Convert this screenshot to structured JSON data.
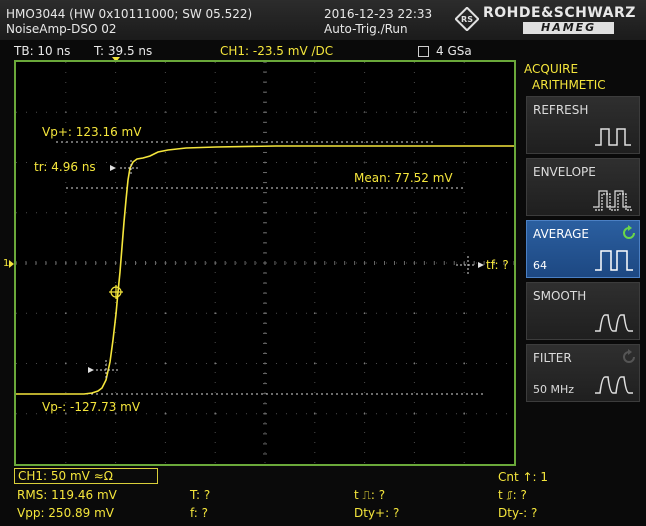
{
  "header": {
    "model": "HMO3044 (HW 0x10111000; SW 05.522)",
    "datetime": "2016-12-23 22:33",
    "setup_name": "NoiseAmp-DSO 02",
    "trigger_mode": "Auto-Trig./Run",
    "brand_line1": "ROHDE&SCHWARZ",
    "brand_line2": "HAMEG"
  },
  "status": {
    "timebase": "TB: 10 ns",
    "trigger_pos": "T: 39.5 ns",
    "ch1_trigger": "CH1: -23.5 mV ∕DC",
    "sample_rate": "4 GSa"
  },
  "plot": {
    "vp_plus": "Vp+: 123.16 mV",
    "rise_time": "tr: 4.96 ns",
    "mean": "Mean: 77.52 mV",
    "fall_time": "tf: ?",
    "vp_minus": "Vp-: -127.73 mV",
    "ch_marker": "1"
  },
  "menu": {
    "title1": "ACQUIRE",
    "title2": "ARITHMETIC",
    "items": [
      {
        "label": "REFRESH",
        "sub": ""
      },
      {
        "label": "ENVELOPE",
        "sub": ""
      },
      {
        "label": "AVERAGE",
        "sub": "64"
      },
      {
        "label": "SMOOTH",
        "sub": ""
      },
      {
        "label": "FILTER",
        "sub": "50 MHz"
      }
    ]
  },
  "bottom": {
    "ch1_setting": "CH1: 50 mV ≈Ω",
    "rms": "RMS: 119.46 mV",
    "vpp": "Vpp: 250.89 mV",
    "t_period": "T: ?",
    "freq": "f: ?",
    "pos_width": "t ⎍: ?",
    "duty_pos": "Dty+: ?",
    "count": "Cnt ↑: 1",
    "neg_width": "t ⎎: ?",
    "duty_neg": "Dty-: ?"
  },
  "colors": {
    "trace": "#f5e63c",
    "grid": "#4a4a4a",
    "frame": "#6aa83a",
    "active_menu": "#2b5fa0"
  }
}
